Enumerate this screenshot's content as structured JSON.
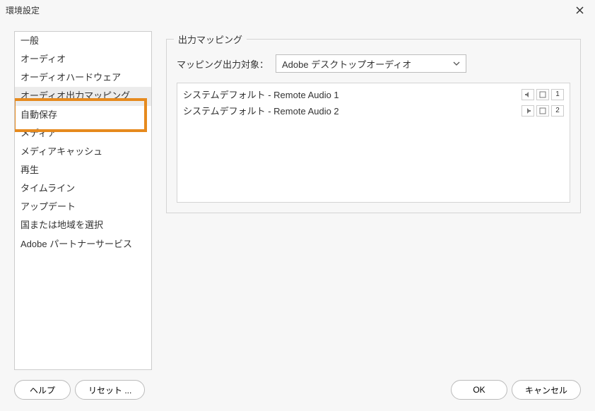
{
  "titlebar": {
    "title": "環境設定"
  },
  "sidebar": {
    "items": [
      {
        "label": "一般",
        "selected": false
      },
      {
        "label": "オーディオ",
        "selected": false
      },
      {
        "label": "オーディオハードウェア",
        "selected": false
      },
      {
        "label": "オーディオ出力マッピング",
        "selected": true
      },
      {
        "label": "自動保存",
        "selected": false
      },
      {
        "label": "メディア",
        "selected": false
      },
      {
        "label": "メディアキャッシュ",
        "selected": false
      },
      {
        "label": "再生",
        "selected": false
      },
      {
        "label": "タイムライン",
        "selected": false
      },
      {
        "label": "アップデート",
        "selected": false
      },
      {
        "label": "国または地域を選択",
        "selected": false
      },
      {
        "label": "Adobe パートナーサービス",
        "selected": false
      }
    ]
  },
  "main": {
    "fieldset_title": "出力マッピング",
    "mapping_target_label": "マッピング出力対象：",
    "mapping_target_value": "Adobe デスクトップオーディオ",
    "items": [
      {
        "label": "システムデフォルト - Remote Audio 1",
        "channel": "1"
      },
      {
        "label": "システムデフォルト - Remote Audio 2",
        "channel": "2"
      }
    ]
  },
  "footer": {
    "help": "ヘルプ",
    "reset": "リセット ...",
    "ok": "OK",
    "cancel": "キャンセル"
  },
  "colors": {
    "highlight": "#e68a1e",
    "border": "#cccccc",
    "text": "#333333"
  }
}
